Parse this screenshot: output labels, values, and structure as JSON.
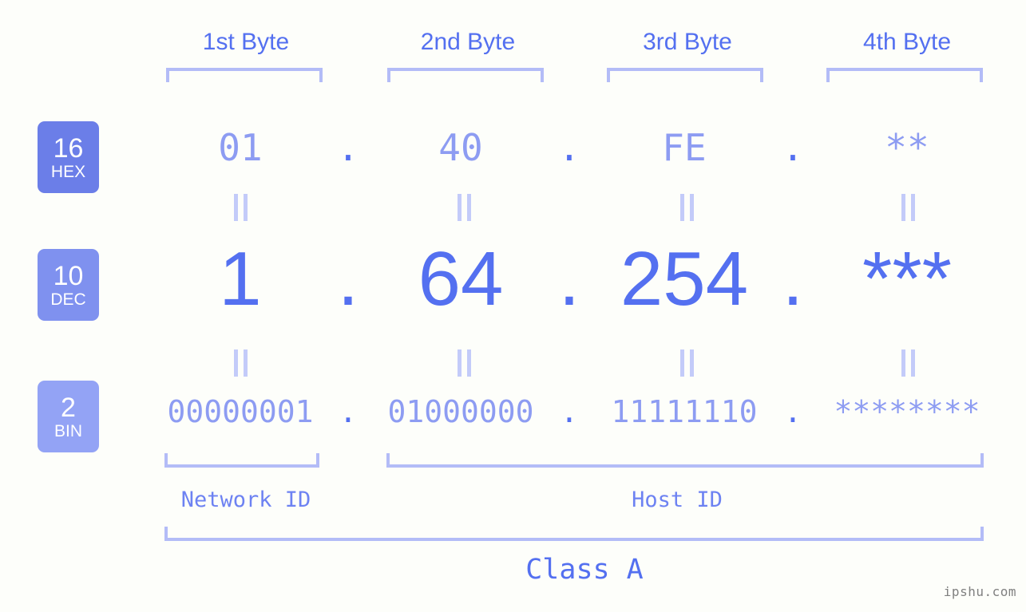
{
  "page": {
    "background": "#fdfefa",
    "accent": "#5470f0",
    "accent_light": "#8d9cf2",
    "bracket_color": "#b3bcf7",
    "watermark": "ipshu.com"
  },
  "headers": [
    {
      "label": "1st Byte"
    },
    {
      "label": "2nd Byte"
    },
    {
      "label": "3rd Byte"
    },
    {
      "label": "4th Byte"
    }
  ],
  "bases": [
    {
      "number": "16",
      "abbr": "HEX",
      "color": "#6b7ee8"
    },
    {
      "number": "10",
      "abbr": "DEC",
      "color": "#7f91ef"
    },
    {
      "number": "2",
      "abbr": "BIN",
      "color": "#93a3f5"
    }
  ],
  "rows": {
    "hex": {
      "base": "16",
      "name": "HEX",
      "values": [
        "01",
        "40",
        "FE",
        "**"
      ],
      "separator": "."
    },
    "dec": {
      "base": "10",
      "name": "DEC",
      "values": [
        "1",
        "64",
        "254",
        "***"
      ],
      "separator": "."
    },
    "bin": {
      "base": "2",
      "name": "BIN",
      "values": [
        "00000001",
        "01000000",
        "11111110",
        "********"
      ],
      "separator": "."
    }
  },
  "equality_symbol": "=",
  "sections": [
    {
      "label": "Network ID"
    },
    {
      "label": "Host ID"
    }
  ],
  "class": {
    "label": "Class A"
  }
}
